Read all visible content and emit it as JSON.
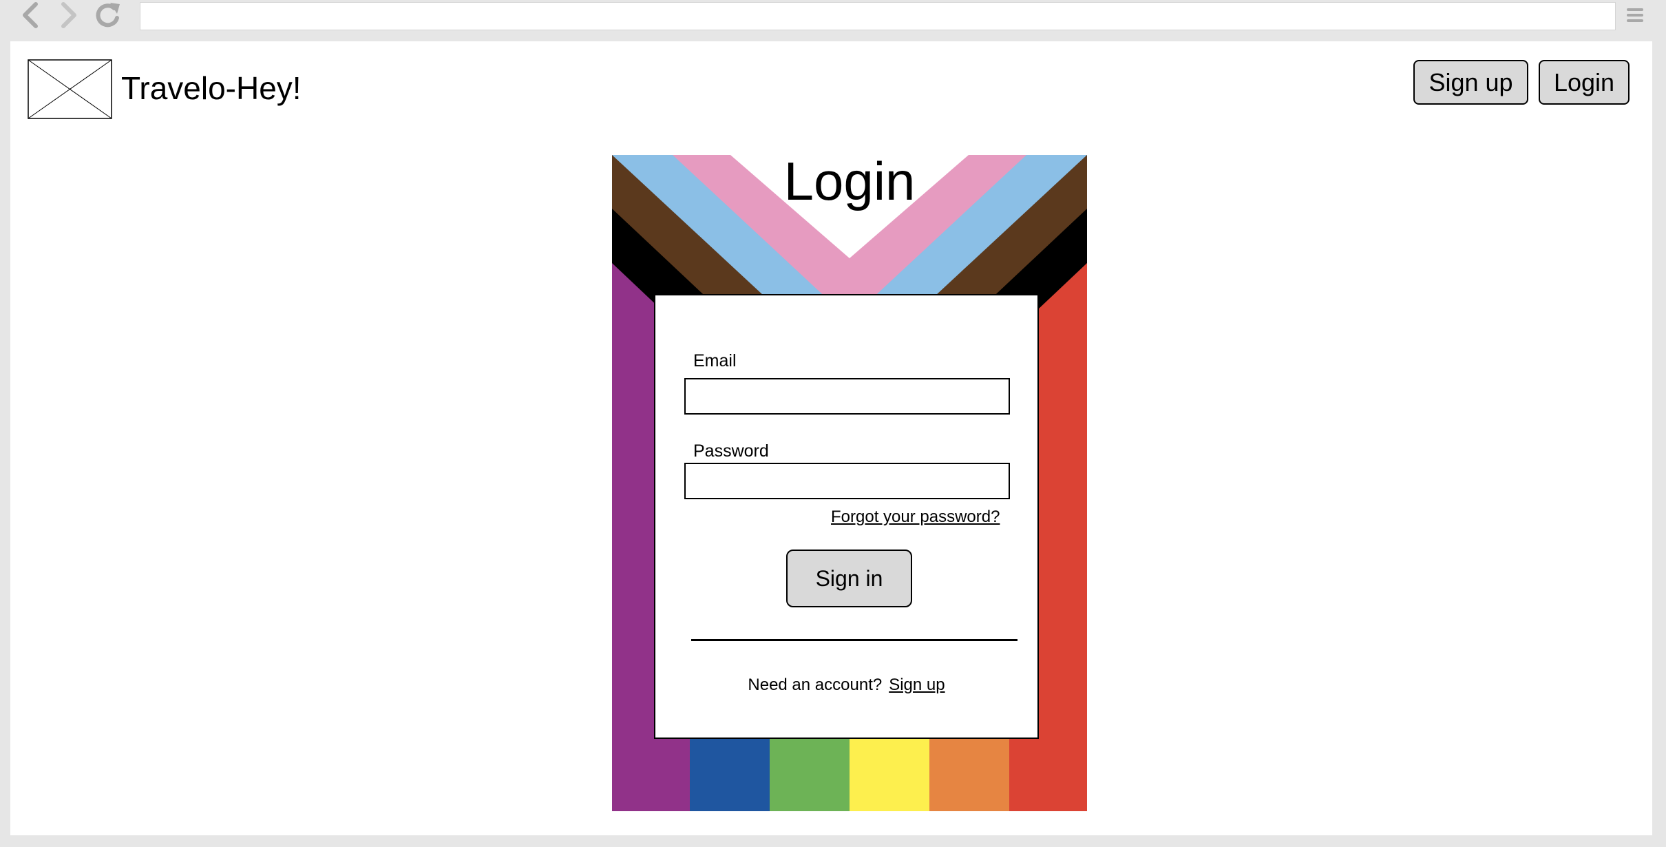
{
  "browser": {
    "back_icon": "chevron-left-icon",
    "forward_icon": "chevron-right-icon",
    "reload_icon": "reload-icon",
    "menu_icon": "hamburger-menu-icon",
    "address_value": ""
  },
  "header": {
    "logo": "image-placeholder",
    "brand": "Travelo-Hey!",
    "signup_label": "Sign up",
    "login_label": "Login"
  },
  "login": {
    "title": "Login",
    "email_label": "Email",
    "email_value": "",
    "password_label": "Password",
    "password_value": "",
    "forgot_label": "Forgot your password?",
    "signin_label": "Sign in",
    "need_account_text": "Need an account?",
    "signup_link": "Sign up"
  },
  "colors": {
    "purple": "#913289",
    "blue": "#1F56A0",
    "green": "#6DB356",
    "yellow": "#FDEF4E",
    "orange": "#E68542",
    "red": "#DB4334",
    "black": "#000000",
    "brown": "#5B391D",
    "light_blue": "#8BBFE6",
    "pink": "#E69BC0",
    "button_gray": "#D9D9D9"
  }
}
